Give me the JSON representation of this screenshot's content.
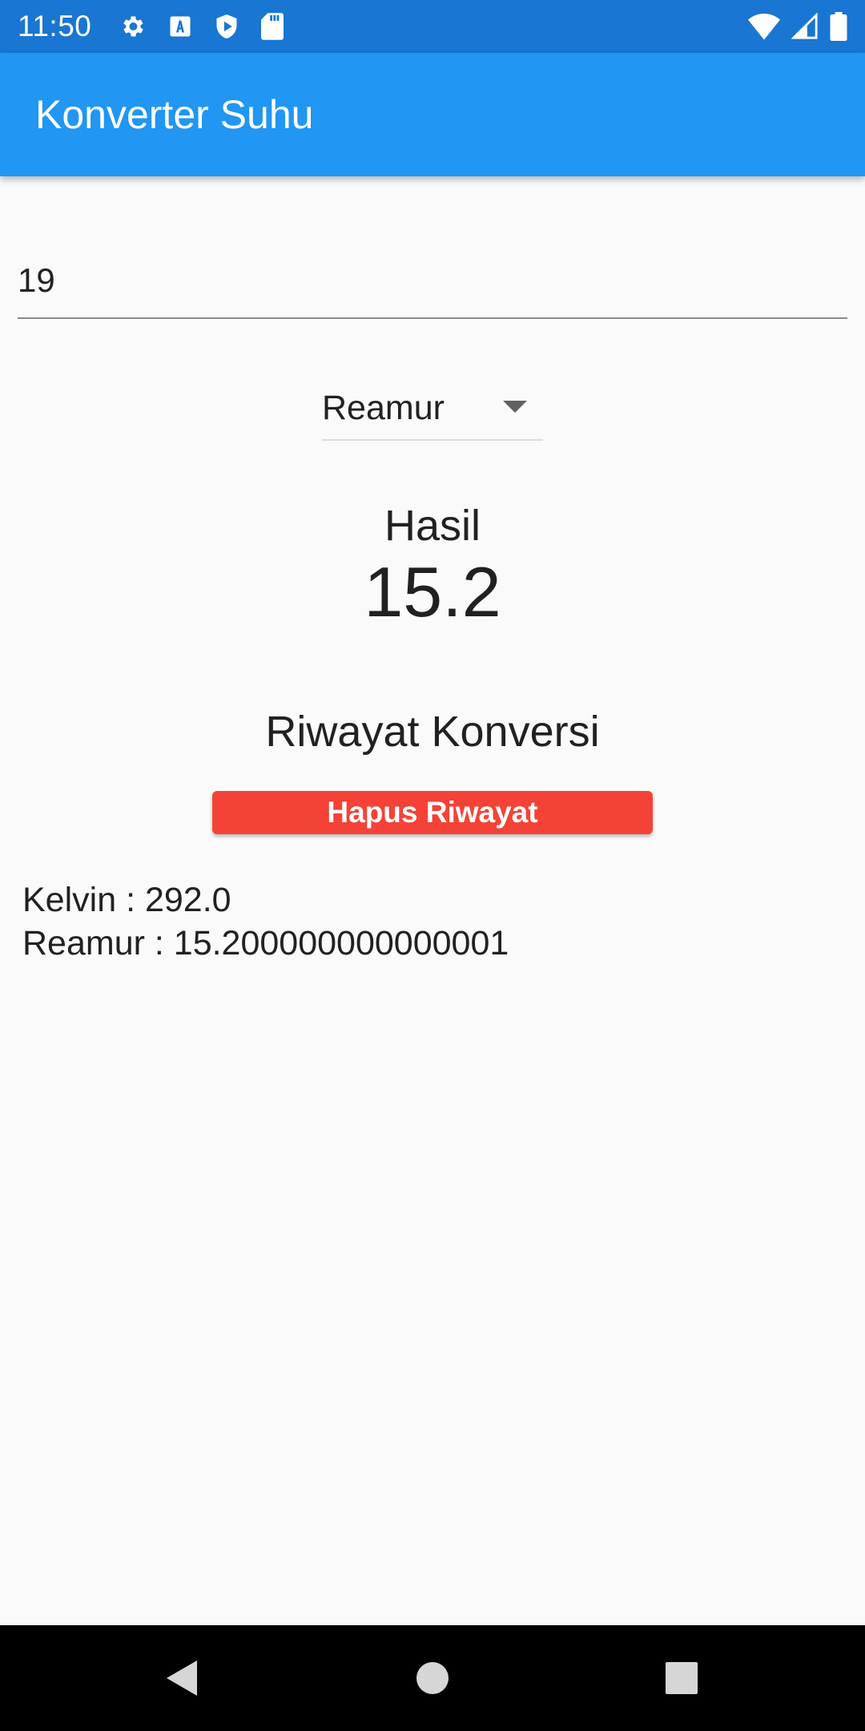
{
  "status_bar": {
    "time": "11:50",
    "icons_left": [
      "gear-icon",
      "text-a-icon",
      "shield-play-icon",
      "sd-card-icon"
    ],
    "icons_right": [
      "wifi-icon",
      "cell-signal-icon",
      "battery-icon"
    ]
  },
  "app_bar": {
    "title": "Konverter Suhu",
    "color": "#2196f3"
  },
  "input": {
    "value": "19"
  },
  "dropdown": {
    "selected": "Reamur"
  },
  "result": {
    "label": "Hasil",
    "value": "15.2"
  },
  "history": {
    "title": "Riwayat Konversi",
    "clear_button_label": "Hapus Riwayat",
    "clear_button_color": "#f44336",
    "items": [
      "Kelvin : 292.0",
      "Reamur : 15.200000000000001"
    ]
  },
  "nav_bar": {
    "buttons": [
      "back-icon",
      "home-icon",
      "recents-icon"
    ]
  }
}
